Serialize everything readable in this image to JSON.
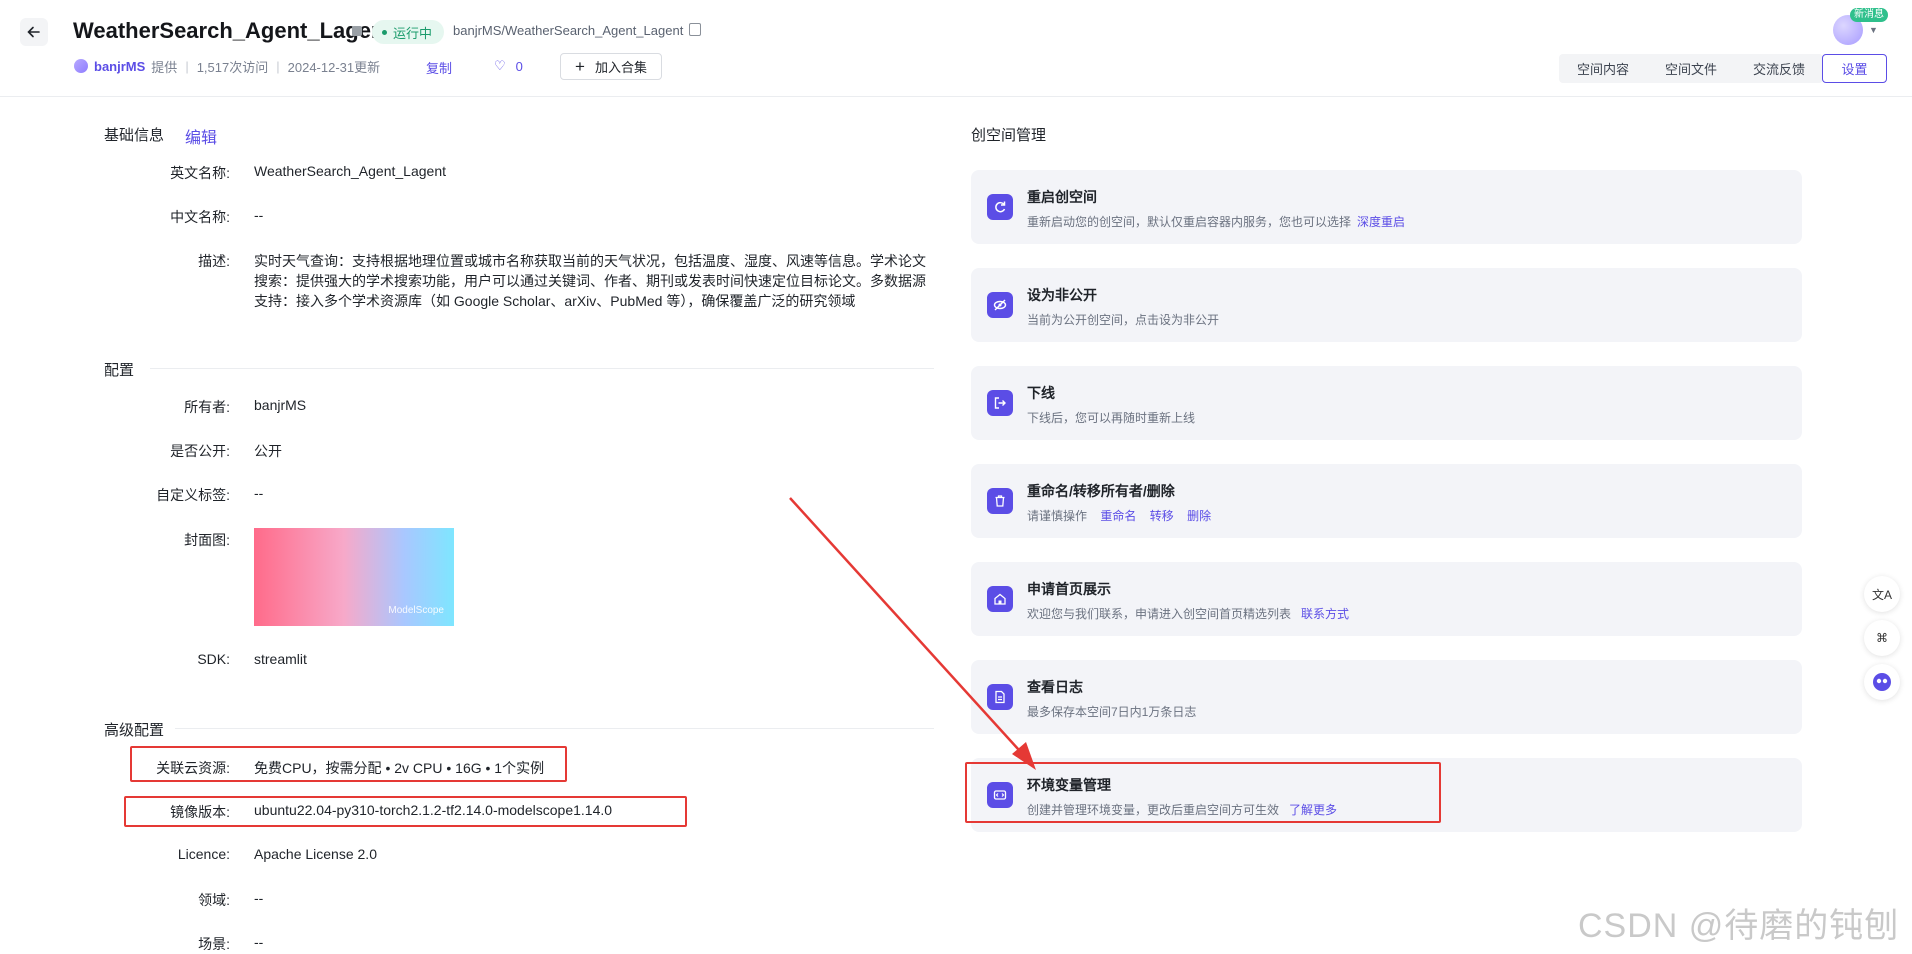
{
  "header": {
    "title": "WeatherSearch_Agent_Lagent",
    "status": "运行中",
    "repo_path": "banjrMS/WeatherSearch_Agent_Lagent",
    "owner": "banjrMS",
    "provided": "提供",
    "visits": "1,517次访问",
    "updated": "2024-12-31更新",
    "copy_label": "复制",
    "like_count": "0",
    "add_collection": "加入合集",
    "new_badge": "新消息",
    "tabs": [
      "空间内容",
      "空间文件",
      "交流反馈"
    ],
    "active_tab": "设置"
  },
  "basic": {
    "title": "基础信息",
    "edit": "编辑",
    "en_name_label": "英文名称:",
    "en_name": "WeatherSearch_Agent_Lagent",
    "cn_name_label": "中文名称:",
    "cn_name": "--",
    "desc_label": "描述:",
    "desc": "实时天气查询：支持根据地理位置或城市名称获取当前的天气状况，包括温度、湿度、风速等信息。学术论文搜索：提供强大的学术搜索功能，用户可以通过关键词、作者、期刊或发表时间快速定位目标论文。多数据源支持：接入多个学术资源库（如 Google Scholar、arXiv、PubMed 等），确保覆盖广泛的研究领域"
  },
  "config": {
    "title": "配置",
    "owner_label": "所有者:",
    "owner": "banjrMS",
    "public_label": "是否公开:",
    "public": "公开",
    "tags_label": "自定义标签:",
    "tags": "--",
    "cover_label": "封面图:",
    "cover_logo": "ModelScope",
    "sdk_label": "SDK:",
    "sdk": "streamlit"
  },
  "advanced": {
    "title": "高级配置",
    "resource_label": "关联云资源:",
    "resource": "免费CPU，按需分配 • 2v CPU • 16G • 1个实例",
    "image_label": "镜像版本:",
    "image": "ubuntu22.04-py310-torch2.1.2-tf2.14.0-modelscope1.14.0",
    "licence_label": "Licence:",
    "licence": "Apache License 2.0",
    "domain_label": "领域:",
    "domain": "--",
    "scene_label": "场景:",
    "scene": "--"
  },
  "manage": {
    "title": "创空间管理",
    "cards": [
      {
        "title": "重启创空间",
        "desc": "重新启动您的创空间，默认仅重启容器内服务，您也可以选择",
        "link": "深度重启",
        "icon": "refresh-icon"
      },
      {
        "title": "设为非公开",
        "desc": "当前为公开创空间，点击设为非公开",
        "icon": "eye-off-icon"
      },
      {
        "title": "下线",
        "desc": "下线后，您可以再随时重新上线",
        "icon": "exit-icon"
      },
      {
        "title": "重命名/转移所有者/删除",
        "desc": "请谨慎操作",
        "links": [
          "重命名",
          "转移",
          "删除"
        ],
        "icon": "trash-icon"
      },
      {
        "title": "申请首页展示",
        "desc": "欢迎您与我们联系，申请进入创空间首页精选列表",
        "link": "联系方式",
        "icon": "home-icon"
      },
      {
        "title": "查看日志",
        "desc": "最多保存本空间7日内1万条日志",
        "icon": "document-icon"
      },
      {
        "title": "环境变量管理",
        "desc": "创建并管理环境变量，更改后重启空间方可生效",
        "link": "了解更多",
        "icon": "code-icon"
      }
    ]
  },
  "side_tools": {
    "translate": "文A",
    "apps": "⌘"
  },
  "watermark": "CSDN @待磨的钝刨",
  "colors": {
    "accent": "#5b4de6",
    "status_green": "#1a9b6b",
    "annotation_red": "#e53935"
  }
}
